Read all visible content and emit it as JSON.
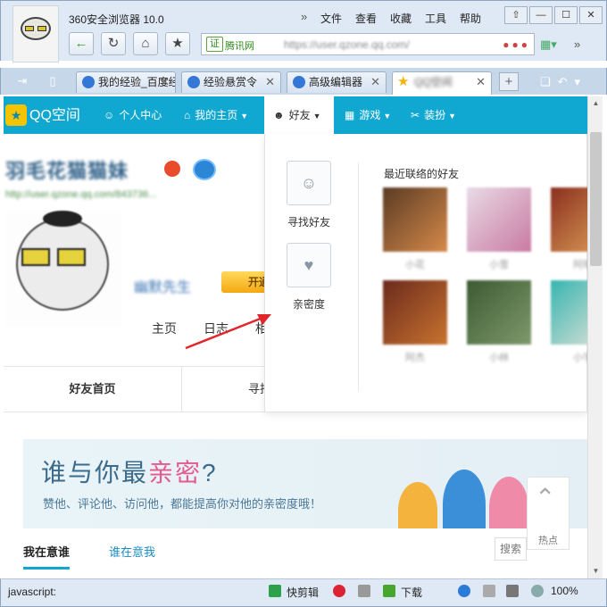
{
  "browser": {
    "title": "360安全浏览器 10.0",
    "menu": [
      "文件",
      "查看",
      "收藏",
      "工具",
      "帮助"
    ],
    "window_buttons": [
      "⇧",
      "—",
      "☐",
      "✕"
    ],
    "cert_label": "证",
    "site_name": "腾讯网",
    "url": "https://user.qzone.qq.com/",
    "tabs": [
      {
        "label": "我的经验_百度经验",
        "icon": "paw-icon"
      },
      {
        "label": "经验悬赏令",
        "icon": "paw-icon"
      },
      {
        "label": "高级编辑器",
        "icon": "paw-icon"
      },
      {
        "label": "QQ空间",
        "icon": "star-icon"
      }
    ],
    "status_left": "javascript:",
    "status_items": {
      "quick_edit": "快剪辑",
      "download": "下载",
      "zoom": "100%"
    }
  },
  "qzone": {
    "logo": "QQ空间",
    "nav": [
      {
        "label": "个人中心",
        "icon": "user-icon"
      },
      {
        "label": "我的主页",
        "icon": "home-icon"
      },
      {
        "label": "好友",
        "icon": "friends-icon"
      },
      {
        "label": "游戏",
        "icon": "grid-icon"
      },
      {
        "label": "装扮",
        "icon": "shirt-icon"
      }
    ],
    "profile": {
      "name": "羽毛花猫猫妹",
      "sub": "http://user.qzone.qq.com/843736...",
      "nick": "幽默先生",
      "vip": "开通"
    },
    "subnav": [
      "主页",
      "日志",
      "相册"
    ],
    "tabs": [
      "好友首页",
      "寻找好友"
    ],
    "banner": {
      "title_a": "谁与你最",
      "title_b": "亲密",
      "title_c": "?",
      "subtitle": "赞他、评论他、访问他，都能提高你对他的亲密度哦！"
    },
    "bottom_tabs": [
      "我在意谁",
      "谁在意我"
    ],
    "float": {
      "label": "热点",
      "search": "搜索"
    },
    "dropdown": {
      "find_friends": "寻找好友",
      "intimacy": "亲密度",
      "recent_heading": "最近联络的好友",
      "friends": [
        {
          "name": "小花",
          "color1": "#5b3b24",
          "color2": "#d68a4a"
        },
        {
          "name": "小雪",
          "color1": "#e8dbe6",
          "color2": "#c97aa2"
        },
        {
          "name": "阿明",
          "color1": "#8a2f1f",
          "color2": "#e2a45b"
        },
        {
          "name": "阿杰",
          "color1": "#6b2a1c",
          "color2": "#c8732e"
        },
        {
          "name": "小林",
          "color1": "#3c5a34",
          "color2": "#7e9a6a"
        },
        {
          "name": "小宇",
          "color1": "#37b5b0",
          "color2": "#e9e4da"
        }
      ]
    }
  },
  "colors": {
    "qzone_blue": "#10a8d0",
    "accent_pink": "#e25b8c",
    "arrow_red": "#e0262b"
  }
}
